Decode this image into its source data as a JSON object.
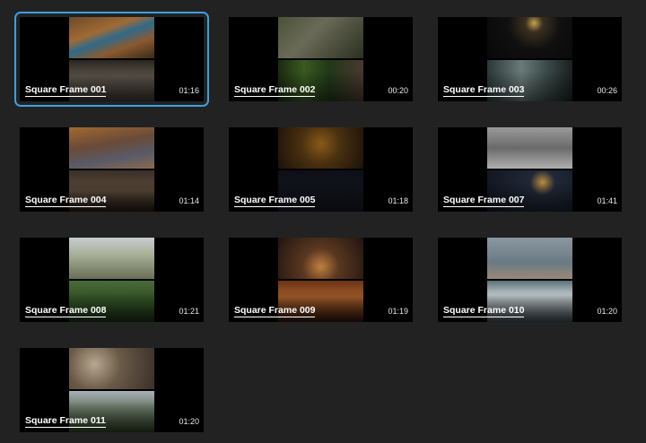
{
  "selected_index": 0,
  "clips": [
    {
      "title": "Square Frame 001",
      "duration": "01:16",
      "top": "linear-gradient(160deg,#6b4a2a 0%,#a06a35 35%,#2f6a8a 50%,#8a5a30 70%,#3a2a18 100%)",
      "bottom": "linear-gradient(180deg,#2a2620 0%,#5a5248 40%,#3a3630 100%)"
    },
    {
      "title": "Square Frame 002",
      "duration": "00:20",
      "top": "linear-gradient(135deg,#4a5238 0%,#6a6a58 40%,#2a3020 100%)",
      "bottom": "linear-gradient(90deg,#1a2a10 0%,#3a5a20 30%,#203818 60%,#4a3830 100%)"
    },
    {
      "title": "Square Frame 003",
      "duration": "00:26",
      "top": "radial-gradient(circle at 55% 15%,#c8a050 0%,#3a3020 15%,#101010 45%,#080808 100%)",
      "bottom": "linear-gradient(90deg,#2a3838 0%,#6a7a78 40%,#3a4a48 70%,#1a2020 100%)"
    },
    {
      "title": "Square Frame 004",
      "duration": "01:14",
      "top": "linear-gradient(170deg,#a06a30 0%,#6a4a38 40%,#5a5a68 70%,#8a6a50 100%)",
      "bottom": "linear-gradient(180deg,#3a3028 0%,#5a4a3a 50%,#201812 100%)"
    },
    {
      "title": "Square Frame 005",
      "duration": "01:18",
      "top": "radial-gradient(circle at 50% 40%,#8a5a18 0%,#4a3010 40%,#1a1208 100%)",
      "bottom": "linear-gradient(180deg,#0e1018 0%,#15161e 100%)"
    },
    {
      "title": "Square Frame 007",
      "duration": "01:41",
      "top": "linear-gradient(180deg,#9a9a9a 0%,#6a6a6a 50%,#b0b0b0 100%)",
      "bottom": "radial-gradient(circle at 65% 30%,#c09040 0%,#202838 20%,#10141c 100%)"
    },
    {
      "title": "Square Frame 008",
      "duration": "01:21",
      "top": "linear-gradient(180deg,#c8ccd0 0%,#a8b098 40%,#6a7058 100%)",
      "bottom": "linear-gradient(180deg,#4a6a38 0%,#2a4a20 60%,#1a2a14 100%)"
    },
    {
      "title": "Square Frame 009",
      "duration": "01:19",
      "top": "radial-gradient(circle at 50% 70%,#c08040 0%,#5a3820 35%,#201410 100%)",
      "bottom": "linear-gradient(180deg,#6a3418 0%,#a05a28 40%,#2a1408 100%)"
    },
    {
      "title": "Square Frame 010",
      "duration": "01:20",
      "top": "linear-gradient(180deg,#8a98a0 0%,#6a7a84 60%,#9a8878 100%)",
      "bottom": "linear-gradient(180deg,#5a7078 0%,#c0c8cc 35%,#3a4448 100%)"
    },
    {
      "title": "Square Frame 011",
      "duration": "01:20",
      "top": "radial-gradient(circle at 30% 40%,#b8a890 0%,#6a5a48 40%,#3a3028 100%)",
      "bottom": "linear-gradient(180deg,#a8b0b8 0%,#6a7a6a 40%,#2a3a20 100%)"
    }
  ]
}
